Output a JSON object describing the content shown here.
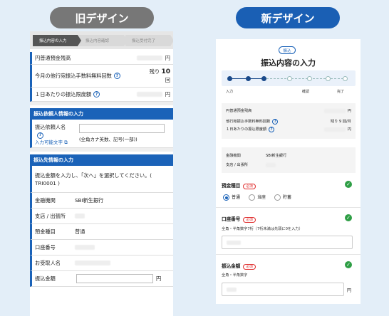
{
  "headings": {
    "old": "旧デザイン",
    "new": "新デザイン"
  },
  "old": {
    "steps": [
      "振込内容の入力",
      "振込内容確認",
      "振込受付完了"
    ],
    "balance_label": "円普通預金残高",
    "balance_unit": "円",
    "fee_label": "今月の他行宛振込手数料無料回数",
    "fee_prefix": "残り",
    "fee_value": "10",
    "fee_unit": "回",
    "limit_label": "１日あたりの振込限度額",
    "limit_unit": "円",
    "requester_section": "振込依頼人情報の入力",
    "requester_name_label": "振込依頼人名",
    "input_chars_link": "入力可能文字",
    "requester_hint": "(全角カナ英数、記号(一部))",
    "payee_section": "振込先情報の入力",
    "instruction": "振込金額を入力し、「次へ」を選択してください。( TRI0001 )",
    "bank_label": "金融機関",
    "bank_value": "SBI新生銀行",
    "branch_label": "支店 / 出張所",
    "deposit_type_label": "預金種目",
    "deposit_type_value": "普通",
    "account_label": "口座番号",
    "recipient_label": "お受取人名",
    "amount_label": "振込金額",
    "amount_unit": "円"
  },
  "new": {
    "tag": "振込",
    "title": "振込内容の入力",
    "progress_labels": [
      "入力",
      "確認",
      "完了"
    ],
    "balance_label": "円普通預金残高",
    "balance_unit": "円",
    "fee_label": "他行宛振込手数料無料回数",
    "fee_value": "残り 9 回/月",
    "limit_label": "１日あたりの振込限度額",
    "limit_unit": "円",
    "bank_label": "金融機関",
    "bank_value": "SBI新生銀行",
    "branch_label": "支店 / 出張所",
    "deposit_type_label": "預金種目",
    "required_badge": "必須",
    "deposit_options": [
      "普通",
      "当座",
      "貯蓄"
    ],
    "account_label": "口座番号",
    "account_hint": "全角・半角数字7桁（7桁未満は先頭に0を入力）",
    "amount_label": "振込金額",
    "amount_hint": "全角・半角数字",
    "amount_unit": "円"
  },
  "colors": {
    "brand_blue": "#1a62b8",
    "check_green": "#2e9e45",
    "required_red": "#e03030",
    "old_pill": "#777777",
    "new_pill": "#1a5fb4"
  }
}
